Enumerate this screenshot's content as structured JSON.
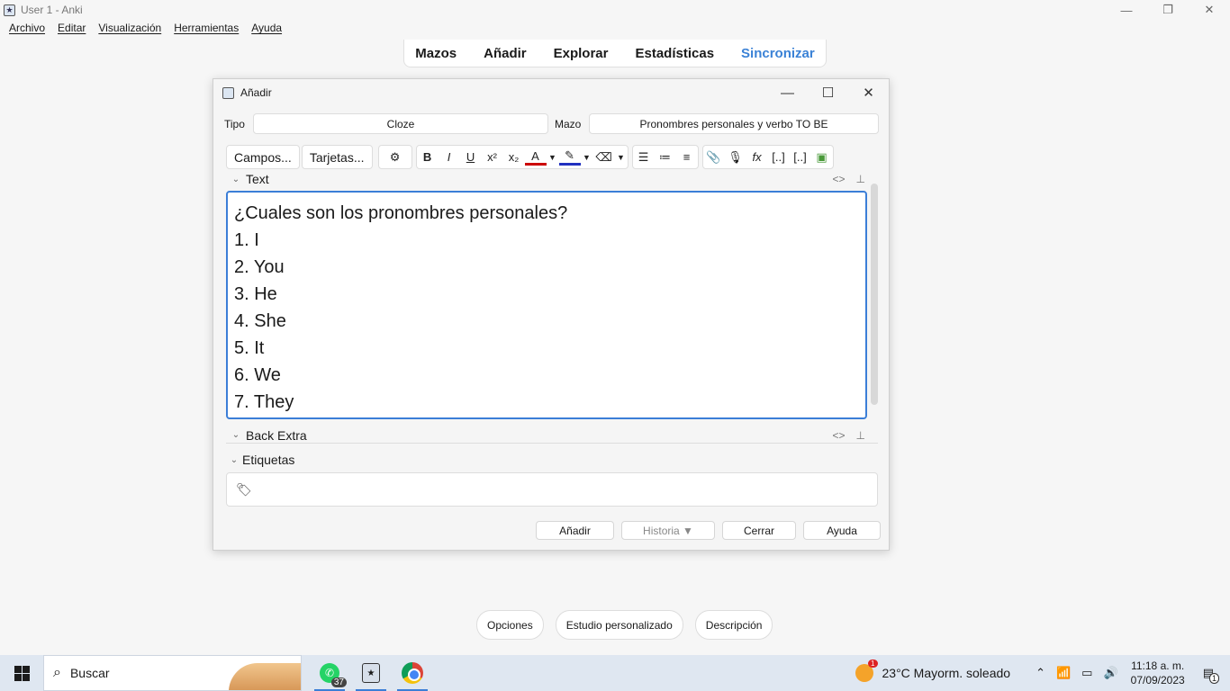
{
  "window": {
    "title": "User 1 - Anki",
    "controls": [
      "—",
      "❐",
      "✕"
    ]
  },
  "menu": [
    "Archivo",
    "Editar",
    "Visualización",
    "Herramientas",
    "Ayuda"
  ],
  "nav": {
    "mazos": "Mazos",
    "anadir": "Añadir",
    "explorar": "Explorar",
    "estadisticas": "Estadísticas",
    "sincronizar": "Sincronizar"
  },
  "dialog": {
    "title": "Añadir",
    "tipo_label": "Tipo",
    "tipo_value": "Cloze",
    "mazo_label": "Mazo",
    "mazo_value": "Pronombres personales y verbo TO BE",
    "toolbar": {
      "campos": "Campos...",
      "tarjetas": "Tarjetas..."
    },
    "fields": {
      "text_label": "Text",
      "text_lines": [
        "¿Cuales son los pronombres personales?",
        "1. I",
        "2. You",
        "3. He",
        "4. She",
        "5. It",
        "6. We",
        "7. They"
      ],
      "back_extra_label": "Back Extra",
      "etiquetas_label": "Etiquetas"
    },
    "buttons": {
      "anadir": "Añadir",
      "historia": "Historia ▼",
      "cerrar": "Cerrar",
      "ayuda": "Ayuda"
    }
  },
  "bottom": {
    "opciones": "Opciones",
    "estudio": "Estudio personalizado",
    "descripcion": "Descripción"
  },
  "taskbar": {
    "search_placeholder": "Buscar",
    "whatsapp_badge": "37",
    "weather_badge": "1",
    "weather": "23°C  Mayorm. soleado",
    "time": "11:18 a. m.",
    "date": "07/09/2023",
    "notif_badge": "1"
  },
  "colors": {
    "accent": "#3b7ed7",
    "sync": "#3b82d6"
  }
}
